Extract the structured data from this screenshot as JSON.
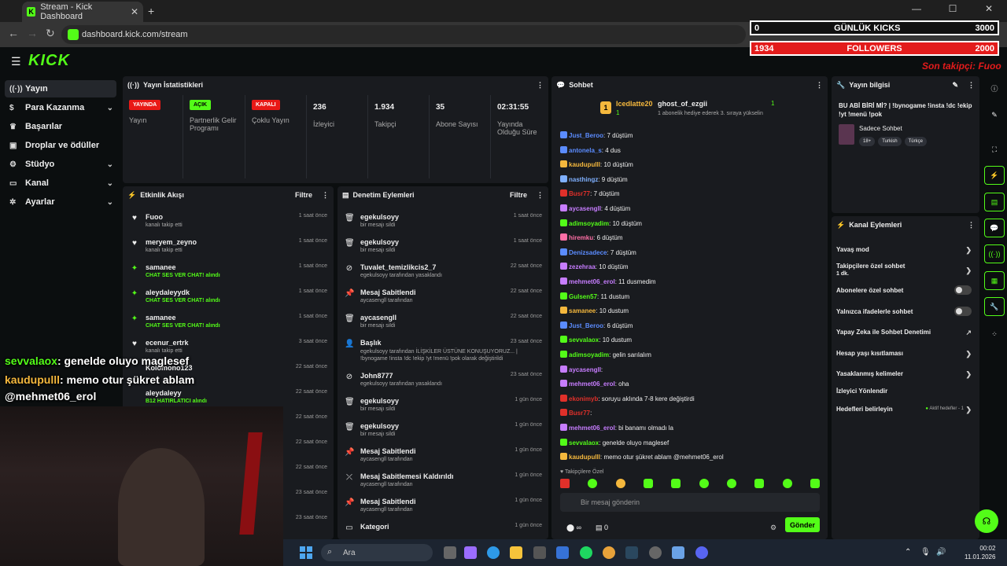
{
  "browser": {
    "tab_title": "Stream - Kick Dashboard",
    "url": "dashboard.kick.com/stream",
    "new_tab": "+",
    "close": "✕"
  },
  "overlay": {
    "kicks_left": "0",
    "kicks_label": "GÜNLÜK KICKS",
    "kicks_right": "3000",
    "followers_left": "1934",
    "followers_label": "FOLLOWERS",
    "followers_right": "2000",
    "last_follower": "Son takipçi: Fuoo"
  },
  "logo": "KICK",
  "sidebar": {
    "items": [
      {
        "label": "Yayın",
        "icon": "broadcast-icon"
      },
      {
        "label": "Para Kazanma",
        "icon": "dollar-icon"
      },
      {
        "label": "Başarılar",
        "icon": "trophy-icon"
      },
      {
        "label": "Droplar ve ödüller",
        "icon": "gift-icon"
      },
      {
        "label": "Stüdyo",
        "icon": "studio-icon"
      },
      {
        "label": "Kanal",
        "icon": "channel-icon"
      },
      {
        "label": "Ayarlar",
        "icon": "gear-icon"
      }
    ]
  },
  "stats": {
    "title": "Yayın İstatistikleri",
    "items": [
      {
        "badge": "YAYINDA",
        "label": "Yayın",
        "color": "#e91916"
      },
      {
        "badge": "AÇIK",
        "label": "Partnerlik Gelir Programı",
        "color": "#53fc18"
      },
      {
        "badge": "KAPALI",
        "label": "Çoklu Yayın",
        "color": "#e91916"
      },
      {
        "value": "236",
        "label": "İzleyici"
      },
      {
        "value": "1.934",
        "label": "Takipçi"
      },
      {
        "value": "35",
        "label": "Abone Sayısı"
      },
      {
        "value": "02:31:55",
        "label": "Yayında Olduğu Süre"
      }
    ]
  },
  "events": {
    "title": "Etkinlik Akışı",
    "filter": "Filtre",
    "rows": [
      {
        "name": "Fuoo",
        "desc": "kanalı takip etti",
        "time": "1 saat önce"
      },
      {
        "name": "meryem_zeyno",
        "desc": "kanalı takip etti",
        "time": "1 saat önce"
      },
      {
        "name": "samanee",
        "desc": "CHAT SES VER CHAT! alındı",
        "time": "1 saat önce"
      },
      {
        "name": "aleydaleyydk",
        "desc": "CHAT SES VER CHAT! alındı",
        "time": "1 saat önce"
      },
      {
        "name": "samanee",
        "desc": "CHAT SES VER CHAT! alındı",
        "time": "1 saat önce"
      },
      {
        "name": "ecenur_ertrk",
        "desc": "kanalı takip etti",
        "time": "3 saat önce"
      },
      {
        "name": "Kolomono123",
        "desc": "",
        "time": "22 saat önce"
      },
      {
        "name": "aleydaleyy",
        "desc": "B12 HATIRLATICI alındı",
        "time": "22 saat önce"
      },
      {
        "name": "",
        "desc": "",
        "time": "22 saat önce"
      },
      {
        "name": "",
        "desc": "",
        "time": "22 saat önce"
      },
      {
        "name": "",
        "desc": "",
        "time": "22 saat önce"
      },
      {
        "name": "",
        "desc": "",
        "time": "23 saat önce"
      },
      {
        "name": "",
        "desc": "",
        "time": "23 saat önce"
      },
      {
        "name": "",
        "desc": "",
        "time": "23 saat önce"
      }
    ]
  },
  "mod": {
    "title": "Denetim Eylemleri",
    "filter": "Filtre",
    "rows": [
      {
        "name": "egekulsoyy",
        "desc": "bir mesajı sildi",
        "time": "1 saat önce"
      },
      {
        "name": "egekulsoyy",
        "desc": "bir mesajı sildi",
        "time": "1 saat önce"
      },
      {
        "name": "Tuvalet_temizlikcis2_7",
        "desc": "egekulsoyy tarafından yasaklandı",
        "time": "22 saat önce"
      },
      {
        "name": "Mesaj Sabitlendi",
        "desc": "aycasengll tarafından",
        "time": "22 saat önce"
      },
      {
        "name": "aycasengll",
        "desc": "bir mesajı sildi",
        "time": "22 saat önce"
      },
      {
        "name": "Başlık",
        "desc": "egekulsoyy tarafından İLİŞKİLER ÜSTÜNE KONUŞUYORUZ... | !bynogame !insta !dc !ekip !yt !menü !pok olarak değiştirildi",
        "time": "23 saat önce"
      },
      {
        "name": "John8777",
        "desc": "egekulsoyy tarafından yasaklandı",
        "time": "23 saat önce"
      },
      {
        "name": "egekulsoyy",
        "desc": "bir mesajı sildi",
        "time": "1 gün önce"
      },
      {
        "name": "egekulsoyy",
        "desc": "bir mesajı sildi",
        "time": "1 gün önce"
      },
      {
        "name": "Mesaj Sabitlendi",
        "desc": "aycasengll tarafından",
        "time": "1 gün önce"
      },
      {
        "name": "Mesaj Sabitlemesi Kaldırıldı",
        "desc": "aycasengll tarafından",
        "time": "1 gün önce"
      },
      {
        "name": "Mesaj Sabitlendi",
        "desc": "aycasengll tarafından",
        "time": "1 gün önce"
      },
      {
        "name": "Kategori",
        "desc": "",
        "time": "1 gün önce"
      }
    ]
  },
  "chat": {
    "title": "Sohbet",
    "gifter": "Icedlatte20",
    "gift_count": "1",
    "recipient": "ghost_of_ezgii",
    "recipient_count": "1",
    "gift_text": "1 abonelik hediye ederek 3. sıraya yükselin",
    "followers_only": "Takipçilere Özel",
    "input_placeholder": "Bir mesaj gönderin",
    "send": "Gönder",
    "infinity": "∞",
    "count": "0",
    "messages": [
      {
        "user": "Just_Beroo",
        "text": ": 7 düştüm",
        "color": "#5b8cff"
      },
      {
        "user": "antonela_s",
        "text": ": 4 dus",
        "color": "#5b8cff"
      },
      {
        "user": "kaudupulll",
        "text": ": 10 düştüm",
        "color": "#f5b83d"
      },
      {
        "user": "nasthingz",
        "text": ": 9 düştüm",
        "color": "#7fb0ff"
      },
      {
        "user": "Busr77",
        "text": ": 7 düştüm",
        "color": "#e0302a"
      },
      {
        "user": "aycasengll",
        "text": ": 4 düştüm",
        "color": "#c77dff"
      },
      {
        "user": "adimsoyadim",
        "text": ": 10 düştüm",
        "color": "#53fc18"
      },
      {
        "user": "hiremku",
        "text": ": 6 düştüm",
        "color": "#ff6fa6"
      },
      {
        "user": "Denizsadece",
        "text": ": 7 düştüm",
        "color": "#5b8cff"
      },
      {
        "user": "zezehraa",
        "text": ": 10 düştüm",
        "color": "#c77dff"
      },
      {
        "user": "mehmet06_erol",
        "text": ": 11 dusmedim",
        "color": "#c77dff"
      },
      {
        "user": "Gulsen57",
        "text": ": 11 dustum",
        "color": "#53fc18"
      },
      {
        "user": "samanee",
        "text": ": 10 dustum",
        "color": "#f5b83d"
      },
      {
        "user": "Just_Beroo",
        "text": ": 6 düştüm",
        "color": "#5b8cff"
      },
      {
        "user": "sevvalaox",
        "text": ": 10 dustum",
        "color": "#53fc18"
      },
      {
        "user": "adimsoyadim",
        "text": ": gelin sarılalım",
        "color": "#53fc18"
      },
      {
        "user": "aycasengll",
        "text": ":",
        "color": "#c77dff"
      },
      {
        "user": "mehmet06_erol",
        "text": ": oha",
        "color": "#c77dff"
      },
      {
        "user": "ekonimyb",
        "text": ": soruyu aklında 7-8 kere değiştirdi",
        "color": "#e0302a"
      },
      {
        "user": "Busr77",
        "text": ":",
        "color": "#e0302a"
      },
      {
        "user": "mehmet06_erol",
        "text": ": bi banamı olmadı la",
        "color": "#c77dff"
      },
      {
        "user": "sevvalaox",
        "text": ": genelde oluyo maglesef",
        "color": "#53fc18"
      },
      {
        "user": "kaudupulll",
        "text": ": memo otur şükret ablam @mehmet06_erol",
        "color": "#f5b83d"
      }
    ]
  },
  "info": {
    "title": "Yayın bilgisi",
    "stream_title": "BU ABİ BİRİ Mİ? | !bynogame !insta !dc !ekip !yt !menü !pok",
    "category": "Sadece Sohbet",
    "tags": [
      "18+",
      "Turkish",
      "Türkçe"
    ]
  },
  "actions": {
    "title": "Kanal Eylemleri",
    "items": [
      "Yavaş mod",
      "Takipçilere özel sohbet",
      "Abonelere özel sohbet",
      "Yalnızca ifadelerle sohbet",
      "Yapay Zeka ile Sohbet Denetimi",
      "Hesap yaşı kısıtlaması",
      "Yasaklanmış kelimeler",
      "İzleyici Yönlendir",
      "Hedefleri belirleyin"
    ],
    "followers_sub": "1 dk.",
    "goals_active": "Aktif hedefler - 1"
  },
  "overlay_chat": {
    "line1_user": "sevvalaox",
    "line1_text": ": genelde oluyo maglesef",
    "line2_user": "kaudupulll",
    "line2_text": ": memo otur şükret ablam",
    "line3": "@mehmet06_erol"
  },
  "taskbar": {
    "search": "Ara",
    "time": "00:02",
    "date": "11.01.2026"
  }
}
